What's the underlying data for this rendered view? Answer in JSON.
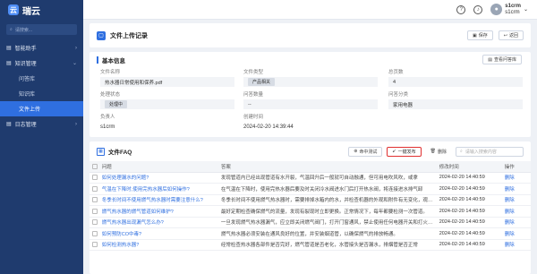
{
  "app": {
    "logo_text": "瑞云",
    "logo_glyph": "云"
  },
  "sidebar": {
    "search_placeholder": "请搜索...",
    "items": [
      {
        "label": "智能助手",
        "type": "group"
      },
      {
        "label": "知识管理",
        "type": "group"
      },
      {
        "label": "问答库",
        "type": "sub"
      },
      {
        "label": "知识库",
        "type": "sub"
      },
      {
        "label": "文件上传",
        "type": "sub",
        "active": true
      },
      {
        "label": "日志管理",
        "type": "group"
      }
    ]
  },
  "topbar": {
    "user_name": "s1crm",
    "user_sub": "s1crm",
    "help_glyph": "?",
    "bell_glyph": "♫"
  },
  "page": {
    "title": "文件上传记录",
    "save_label": "保存",
    "back_label": "返回"
  },
  "basic_info": {
    "section_title": "基本信息",
    "view_kb_label": "查看问答库",
    "fields": {
      "file_name_label": "文件名称",
      "file_name": "热水器日常使用和保养.pdf",
      "file_type_label": "文件类型",
      "file_type": "产品相关",
      "pages_label": "总页数",
      "pages": "4",
      "status_label": "处理状态",
      "status": "处理中",
      "qa_count_label": "问答数量",
      "qa_count": "--",
      "category_label": "问答分类",
      "category": "家用电器",
      "owner_label": "负责人",
      "owner": "s1crm",
      "created_label": "创建时间",
      "created": "2024-02-20 14:39:44"
    }
  },
  "faq": {
    "title": "文件FAQ",
    "hit_test_label": "命中测试",
    "publish_label": "一键发布",
    "delete_label": "删除",
    "search_placeholder": "请输入搜索内容",
    "columns": {
      "question": "问题",
      "answer": "答案",
      "time": "修改时间",
      "action": "操作"
    },
    "rows": [
      {
        "question": "如何处理漏水的问题?",
        "answer": "发现管道内已经出现管道有水开裂，气温回升后一般就可自动融通，但可用电吹风吹，或拿",
        "time": "2024-02-20 14:40:59",
        "action": "删除"
      },
      {
        "question": "气温在下降时,使用完热水器后如何操作?",
        "answer": "在气温在下降时，使用完热水器后要及时关闭冷水阀进水门后打开热水阀，将连接进水排气卸",
        "time": "2024-02-20 14:40:59",
        "action": "删除"
      },
      {
        "question": "冬季长时间不使用燃气热水器时需要注意什么?",
        "answer": "冬季长时间不使用燃气热水器时，需要排掉水箱内的水，并检查机器的外观和附件有无变化，观察有",
        "time": "2024-02-20 14:40:59",
        "action": "删除"
      },
      {
        "question": "燃气热水器的燃气管道如何维护?",
        "answer": "最好定期检查确保燃气的流量，发现有裂现时立即更换。正常情况下，每年都要检测一次管道。",
        "time": "2024-02-20 14:40:59",
        "action": "删除"
      },
      {
        "question": "燃气热水器出现漏气怎么办?",
        "answer": "一旦发现燃气热水器漏气，应立即关闭燃气阀门，打开门窗通风，禁止使用任何电器开关和打火设备",
        "time": "2024-02-20 14:40:59",
        "action": "删除"
      },
      {
        "question": "如何预防CO中毒?",
        "answer": "燃气热水器必须安装在通风良好的位置，并安装烟道管，以确保燃气的排放畅通。",
        "time": "2024-02-20 14:40:59",
        "action": "删除"
      },
      {
        "question": "如何检测热水器?",
        "answer": "经常检查热水器各部件是否完好，燃气管道是否老化，水管接头是否漏水，排烟管是否正常",
        "time": "2024-02-20 14:40:59",
        "action": "删除"
      }
    ]
  }
}
